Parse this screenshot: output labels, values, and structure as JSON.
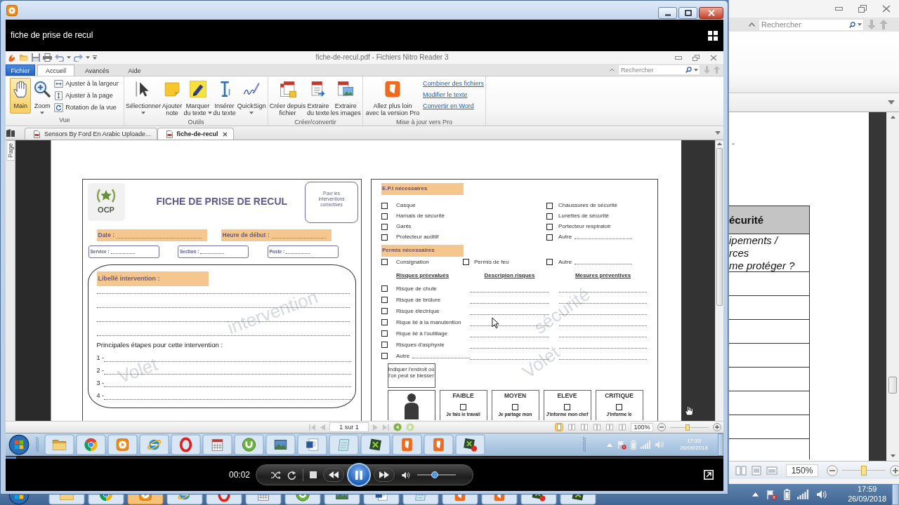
{
  "player": {
    "title": "fiche de prise de recul",
    "time": "00:02",
    "playing": true,
    "progress": {
      "level": 0.015
    },
    "volume": {
      "level": 0.45
    }
  },
  "recording": {
    "window_title": "fiche-de-recul.pdf - Fichiers Nitro Reader 3",
    "ribbon_tabs": [
      {
        "label": "Fichier",
        "kind": "menu",
        "selected": false
      },
      {
        "label": "Accueil",
        "kind": "tab",
        "selected": true
      },
      {
        "label": "Avancés",
        "kind": "tab",
        "selected": false
      },
      {
        "label": "Aide",
        "kind": "tab",
        "selected": false
      }
    ],
    "search": {
      "placeholder": "Rechercher"
    },
    "ribbon_groups": [
      {
        "label": "Vue",
        "items": [
          {
            "kind": "large",
            "lines": [
              "Main"
            ],
            "dropdown": false,
            "selected": true
          },
          {
            "kind": "large",
            "lines": [
              "Zoom"
            ],
            "dropdown": true,
            "selected": false
          },
          {
            "kind": "small",
            "lines": [
              "Ajuster à la largeur"
            ],
            "dropdown": false,
            "selected": false
          },
          {
            "kind": "small",
            "lines": [
              "Ajuster à la page"
            ],
            "dropdown": false,
            "selected": false
          },
          {
            "kind": "small",
            "lines": [
              "Rotation de la vue"
            ],
            "dropdown": false,
            "selected": false
          }
        ]
      },
      {
        "label": "Outils",
        "items": [
          {
            "kind": "large",
            "lines": [
              "Sélectionner"
            ],
            "dropdown": true,
            "selected": false
          },
          {
            "kind": "large",
            "lines": [
              "Ajouter",
              "note"
            ],
            "dropdown": false,
            "selected": false
          },
          {
            "kind": "large",
            "lines": [
              "Marquer",
              "du texte"
            ],
            "dropdown": true,
            "selected": false
          },
          {
            "kind": "large",
            "lines": [
              "Insérer",
              "du texte"
            ],
            "dropdown": false,
            "selected": false
          },
          {
            "kind": "large",
            "lines": [
              "QuickSign"
            ],
            "dropdown": true,
            "selected": false
          }
        ]
      },
      {
        "label": "Créer/convertir",
        "items": [
          {
            "kind": "large",
            "lines": [
              "Créer depuis",
              "fichier"
            ],
            "dropdown": false,
            "selected": false
          },
          {
            "kind": "large",
            "lines": [
              "Extraire",
              "du texte"
            ],
            "dropdown": false,
            "selected": false
          },
          {
            "kind": "large",
            "lines": [
              "Extraire",
              "les images"
            ],
            "dropdown": false,
            "selected": false
          }
        ]
      },
      {
        "label": "Mise à jour vers Pro",
        "items": [
          {
            "kind": "large",
            "lines": [
              "Allez plus loin",
              "avec la version Pro"
            ],
            "dropdown": false,
            "selected": false
          },
          {
            "kind": "link",
            "lines": [
              "Combiner des fichiers"
            ],
            "dropdown": false,
            "selected": false
          },
          {
            "kind": "link",
            "lines": [
              "Modifier le texte"
            ],
            "dropdown": false,
            "selected": false
          },
          {
            "kind": "link",
            "lines": [
              "Convertir en Word"
            ],
            "dropdown": false,
            "selected": false
          }
        ]
      }
    ],
    "doc_tabs": [
      {
        "label": "Sensors By Ford En Arabic Uploade...",
        "selected": false,
        "closable": false
      },
      {
        "label": "fiche-de-recul",
        "selected": true,
        "closable": true
      }
    ],
    "side_panel": {
      "label": "Page"
    },
    "form": {
      "logo": "OCP",
      "title": "FICHE DE PRISE DE RECUL",
      "scope_note": [
        "Pour les",
        "interventions",
        "correctives"
      ],
      "header_fields": [
        "Date :",
        "Heure de début :"
      ],
      "boxed_fields": [
        "Service :",
        "Section :",
        "Poste :"
      ],
      "intervention": {
        "heading": "Libellé intervention :",
        "steps_title": "Principales étapes pour cette intervention :",
        "steps": [
          "1 -",
          "2 -",
          "3 -",
          "4 -"
        ]
      },
      "watermarks": [
        [
          "Volet",
          "intervention"
        ],
        [
          "Volet",
          "sécurité"
        ]
      ],
      "epi": {
        "heading": "E.P.I nécessaires",
        "left": [
          {
            "label": "Casque",
            "checked": false,
            "blank": false
          },
          {
            "label": "Harnais de sécurité",
            "checked": false,
            "blank": false
          },
          {
            "label": "Gants",
            "checked": false,
            "blank": false
          },
          {
            "label": "Protecteur auditif",
            "checked": false,
            "blank": false
          }
        ],
        "right": [
          {
            "label": "Chaussures de sécurité",
            "checked": false,
            "blank": false
          },
          {
            "label": "Lunettes de sécurité",
            "checked": false,
            "blank": false
          },
          {
            "label": "Portecteur respiratoir",
            "checked": false,
            "blank": false
          },
          {
            "label": "Autre",
            "checked": false,
            "blank": true
          }
        ]
      },
      "permits": {
        "heading": "Permis nécessaires",
        "items": [
          {
            "label": "Consignation",
            "checked": false,
            "blank": false
          },
          {
            "label": "Permis de feu",
            "checked": false,
            "blank": false
          },
          {
            "label": "Autre",
            "checked": false,
            "blank": true
          }
        ]
      },
      "risks": {
        "columns": [
          "Risques préevalués",
          "Descripion risques",
          "Mesures préventives"
        ],
        "items": [
          {
            "label": "Risque de chute",
            "checked": false,
            "blank": false
          },
          {
            "label": "Risque de brûlure",
            "checked": false,
            "blank": false
          },
          {
            "label": "Risque électrique",
            "checked": false,
            "blank": false
          },
          {
            "label": "Rique lié à la manutention",
            "checked": false,
            "blank": false
          },
          {
            "label": "Rique lié à l'outillage",
            "checked": false,
            "blank": false
          },
          {
            "label": "Risques d'asphyxie",
            "checked": false,
            "blank": false
          },
          {
            "label": "Autre",
            "checked": false,
            "blank": true
          }
        ]
      },
      "injury_note": "Indiquer l'endroit où l'on peut se blesser",
      "levels": [
        {
          "label": "FAIBLE",
          "checked": false,
          "text": "Je fais le travail"
        },
        {
          "label": "MOYEN",
          "checked": false,
          "text": "Je partage mon"
        },
        {
          "label": "ELEVE",
          "checked": false,
          "text": "J'informe mon chef"
        },
        {
          "label": "CRITIQUE",
          "checked": false,
          "text": "J'informe le"
        }
      ]
    },
    "status": {
      "page": "1 sur 1",
      "zoom": "100%",
      "zoom_slider": {
        "level": 0.45
      }
    },
    "taskbar": {
      "time": "17:33",
      "date": "26/09/2018"
    }
  },
  "desktop_window": {
    "search": {
      "placeholder": "Rechercher"
    },
    "page_fragment": ".",
    "table": {
      "header": "écurité",
      "question": [
        "ipements /",
        "rces",
        "me protéger ?"
      ]
    },
    "zoom": "150%",
    "zoom_slider": {
      "level": 0.5
    }
  },
  "taskbar": {
    "apps": [
      {
        "selected": false
      },
      {
        "selected": false
      },
      {
        "selected": true
      },
      {
        "selected": false
      },
      {
        "selected": false
      },
      {
        "selected": false
      },
      {
        "selected": false
      },
      {
        "selected": false
      },
      {
        "selected": false
      },
      {
        "selected": false
      },
      {
        "selected": false
      },
      {
        "selected": false
      },
      {
        "selected": false
      },
      {
        "selected": false
      }
    ],
    "time": "17:59",
    "date": "26/09/2018"
  }
}
